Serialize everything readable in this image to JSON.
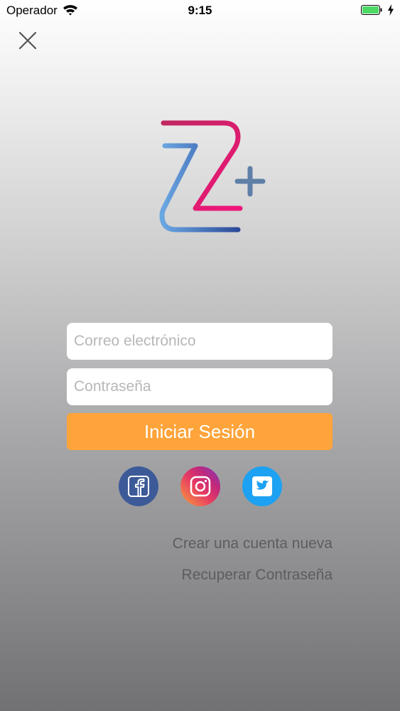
{
  "status_bar": {
    "carrier": "Operador",
    "time": "9:15",
    "icons": [
      "wifi-icon",
      "battery-icon",
      "charging-bolt-icon"
    ]
  },
  "close_icon": "close-icon",
  "logo": {
    "icon": "z-plus-logo",
    "colors": {
      "pink": "#e8157a",
      "blue": "#3a83d1",
      "plus": "#5e7fa6"
    }
  },
  "form": {
    "email_placeholder": "Correo electrónico",
    "email_value": "",
    "password_placeholder": "Contraseña",
    "password_value": "",
    "login_label": "Iniciar Sesión",
    "login_color": "#fea43a"
  },
  "social": [
    {
      "name": "facebook",
      "icon": "facebook-icon",
      "color": "#3d5a98"
    },
    {
      "name": "instagram",
      "icon": "instagram-icon",
      "color": "#e73c63"
    },
    {
      "name": "twitter",
      "icon": "twitter-icon",
      "color": "#1da1f2"
    }
  ],
  "links": {
    "create_account": "Crear una cuenta nueva",
    "recover_password": "Recuperar Contraseña"
  }
}
